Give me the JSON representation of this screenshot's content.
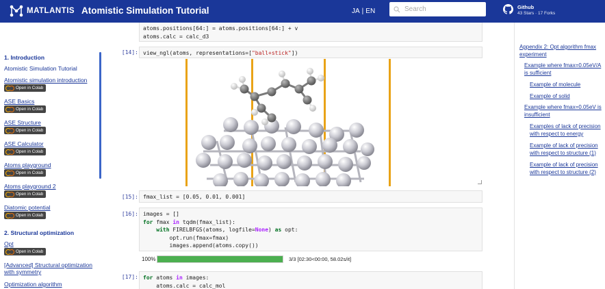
{
  "header": {
    "logo_text": "MATLANTIS",
    "title": "Atomistic Simulation Tutorial",
    "lang_ja": "JA",
    "lang_sep": "|",
    "lang_en": "EN",
    "search_placeholder": "Search",
    "github_title": "Github",
    "github_stats": "43 Stars · 17 Forks"
  },
  "sidebar": {
    "colab_label": "Open in Colab",
    "section1": "1. Introduction",
    "intro_title": "Atomistic Simulation Tutorial",
    "items1": [
      {
        "label": "Atomistic simulation introduction"
      },
      {
        "label": "ASE Basics"
      },
      {
        "label": "ASE Structure"
      },
      {
        "label": "ASE Calculator"
      },
      {
        "label": "Atoms playground"
      },
      {
        "label": "Atoms playground 2"
      },
      {
        "label": "Diatomic potential"
      }
    ],
    "section2": "2. Structural optimization",
    "items2": [
      {
        "label": "Opt"
      },
      {
        "label": "[Advanced] Structural optimization with symmetry"
      },
      {
        "label": "Optimization algorithm"
      }
    ]
  },
  "notebook": {
    "cell_top": {
      "line1": "atoms.positions[64:] = atoms.positions[64:] + v",
      "line2": "atoms.calc = calc_d3"
    },
    "cell14": {
      "prompt": "[14]:",
      "code_a": "view_ngl(atoms, representations=[",
      "code_str": "\"ball+stick\"",
      "code_b": "])"
    },
    "cell15": {
      "prompt": "[15]:",
      "code": "fmax_list = [0.05, 0.01, 0.001]"
    },
    "cell16": {
      "prompt": "[16]:",
      "line1": "images = []",
      "l2_for": "for",
      "l2_mid": " fmax ",
      "l2_in": "in",
      "l2_rest": " tqdm(fmax_list):",
      "l3_with": "with",
      "l3_a": " FIRELBFGS(atoms, logfile=",
      "l3_none": "None",
      "l3_b": ") ",
      "l3_as": "as",
      "l3_c": " opt:",
      "line4": "opt.run(fmax=fmax)",
      "line5": "images.append(atoms.copy())"
    },
    "progress": {
      "percent_label": "100%",
      "fraction": 1.0,
      "info": "3/3 [02:30<00:00, 58.02s/it]"
    },
    "cell17": {
      "prompt": "[17]:",
      "l1_for": "for",
      "l1_mid": " atoms ",
      "l1_in": "in",
      "l1_rest": " images:",
      "line2": "atoms.calc = calc_mol"
    }
  },
  "toc_right": [
    {
      "label": "Appendix 2: Opt algorithm fmax experiment"
    },
    {
      "label": "Example where fmax=0.05eV/A is sufficient"
    },
    {
      "label": "Example of molecule"
    },
    {
      "label": "Example of solid"
    },
    {
      "label": "Example where fmax=0.05eV is insufficient"
    },
    {
      "label": "Examples of lack of precision with respect to energy"
    },
    {
      "label": "Example of lack of precision with respect to structure (1)"
    },
    {
      "label": "Example of lack of precision with respect to structure (2)"
    }
  ],
  "colors": {
    "header_bg": "#1a3799",
    "link": "#1a3799",
    "progress_fill": "#4caf50",
    "colab_orange": "#f9ab00",
    "cell_bar": "#e9a317"
  }
}
